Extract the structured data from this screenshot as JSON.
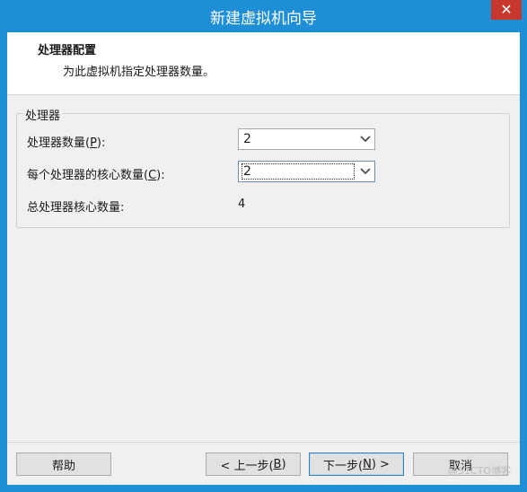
{
  "window": {
    "title": "新建虚拟机向导",
    "close_glyph": "✕"
  },
  "header": {
    "title": "处理器配置",
    "subtitle": "为此虚拟机指定处理器数量。"
  },
  "group": {
    "legend": "处理器",
    "processors": {
      "label": "处理器数量(",
      "hotkey": "P",
      "suffix": "):",
      "value": "2"
    },
    "cores": {
      "label": "每个处理器的核心数量(",
      "hotkey": "C",
      "suffix": "):",
      "value": "2"
    },
    "total": {
      "label": "总处理器核心数量:",
      "value": "4"
    }
  },
  "buttons": {
    "help": "帮助",
    "back": {
      "prefix": "< 上一步(",
      "hotkey": "B",
      "suffix": ")"
    },
    "next": {
      "prefix": "下一步(",
      "hotkey": "N",
      "suffix": ") >"
    },
    "cancel": "取消"
  },
  "watermark": "@51CTO博客",
  "colors": {
    "titlebar": "#1e8ed6",
    "close": "#c7372c",
    "dialog_bg": "#f0f0f0"
  }
}
